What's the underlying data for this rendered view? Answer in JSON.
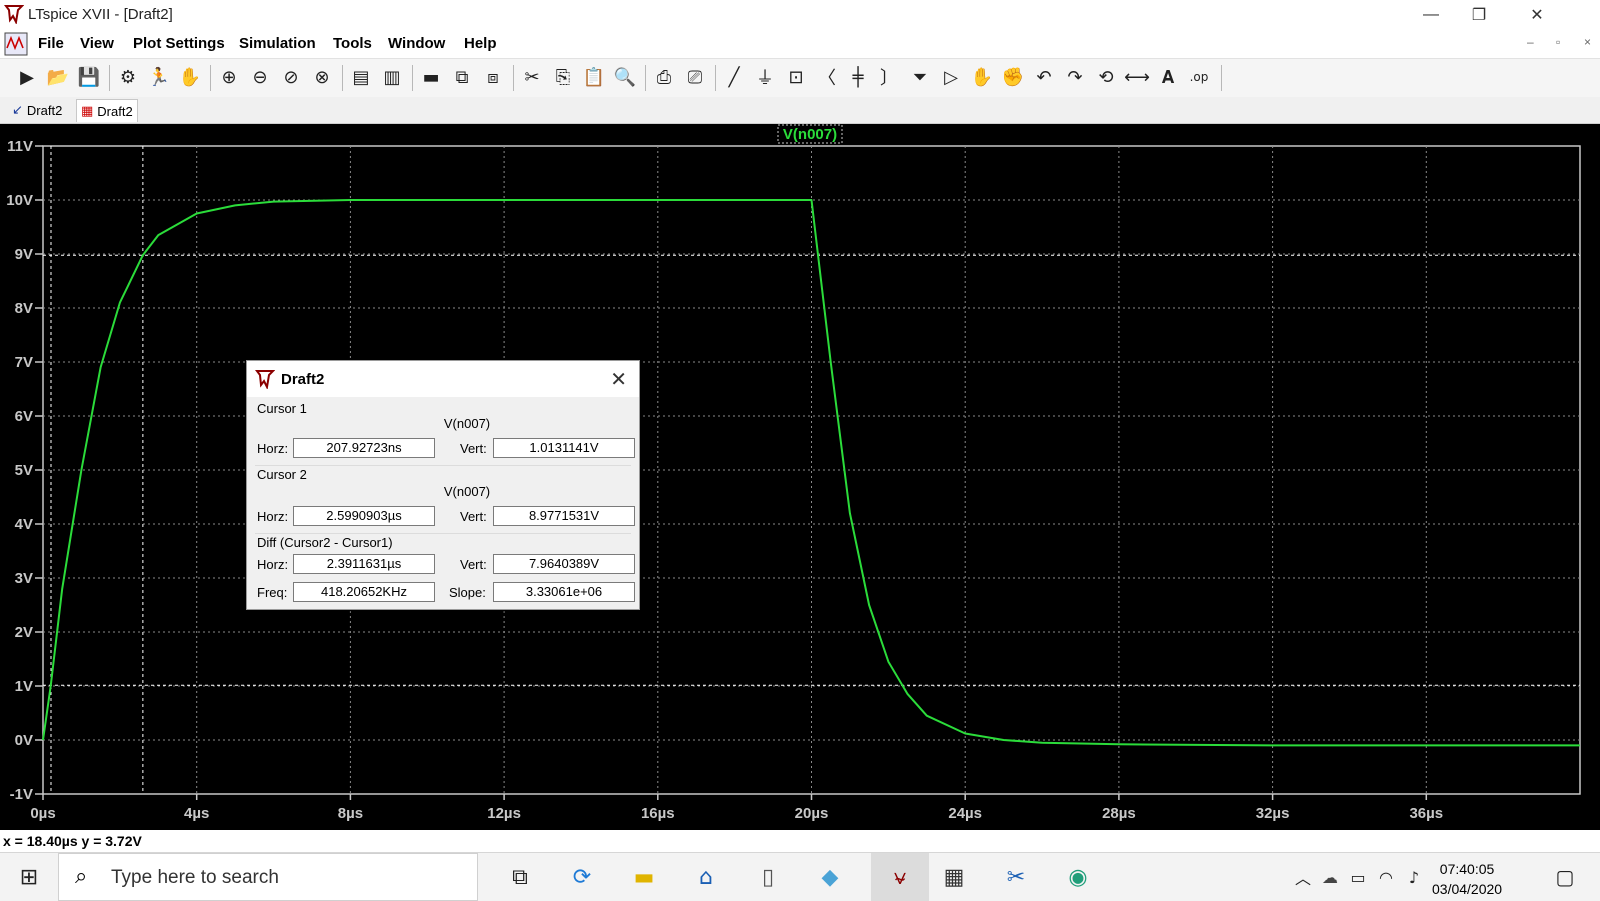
{
  "window": {
    "title": "LTspice XVII - [Draft2]",
    "controls": [
      "—",
      "❐",
      "✕"
    ],
    "mdi_controls": [
      "–",
      "▫",
      "×"
    ]
  },
  "menu": [
    "File",
    "View",
    "Plot Settings",
    "Simulation",
    "Tools",
    "Window",
    "Help"
  ],
  "toolbar_icons": [
    "new-schematic-icon",
    "open-icon",
    "save-icon",
    "control-panel-icon",
    "run-icon",
    "halt-icon",
    "zoom-in-icon",
    "zoom-out-icon",
    "zoom-back-icon",
    "zoom-extents-icon",
    "autorange-icon",
    "manual-limits-icon",
    "add-plot-pane-icon",
    "tile-horizontal-icon",
    "tile-vertical-icon",
    "cut-icon",
    "copy-icon",
    "paste-icon",
    "find-icon",
    "print-icon",
    "print-preview-icon",
    "wire-icon",
    "ground-icon",
    "label-icon",
    "resistor-icon",
    "capacitor-icon",
    "inductor-icon",
    "diode-icon",
    "component-icon",
    "move-icon",
    "drag-icon",
    "undo-icon",
    "redo-icon",
    "rotate-icon",
    "mirror-icon",
    "text-icon",
    "spice-directive-icon"
  ],
  "tabs": [
    "Draft2",
    "Draft2"
  ],
  "plot": {
    "trace_label": "V(n007)",
    "trace_color": "#2bdc3a",
    "background": "#000000"
  },
  "cursor_dialog": {
    "title": "Draft2",
    "cursor1": {
      "label": "Cursor 1",
      "trace": "V(n007)",
      "horz_label": "Horz:",
      "horz": "207.92723ns",
      "vert_label": "Vert:",
      "vert": "1.0131141V"
    },
    "cursor2": {
      "label": "Cursor 2",
      "trace": "V(n007)",
      "horz_label": "Horz:",
      "horz": "2.5990903µs",
      "vert_label": "Vert:",
      "vert": "8.9771531V"
    },
    "diff": {
      "label": "Diff (Cursor2 - Cursor1)",
      "horz_label": "Horz:",
      "horz": "2.3911631µs",
      "vert_label": "Vert:",
      "vert": "7.9640389V",
      "freq_label": "Freq:",
      "freq": "418.20652KHz",
      "slope_label": "Slope:",
      "slope": "3.33061e+06"
    }
  },
  "status_bar": "x = 18.40µs    y = 3.72V",
  "taskbar": {
    "search_placeholder": "Type here to search",
    "time": "07:40:05",
    "date": "03/04/2020"
  },
  "chart_data": {
    "type": "line",
    "title": "",
    "xlabel": "",
    "ylabel": "",
    "xlim": [
      0,
      40
    ],
    "ylim": [
      -1,
      11
    ],
    "x_unit": "µs",
    "y_unit": "V",
    "x_ticks": [
      "0µs",
      "4µs",
      "8µs",
      "12µs",
      "16µs",
      "20µs",
      "24µs",
      "28µs",
      "32µs",
      "36µs"
    ],
    "y_ticks": [
      "11V",
      "10V",
      "9V",
      "8V",
      "7V",
      "6V",
      "5V",
      "4V",
      "3V",
      "2V",
      "1V",
      "0V",
      "-1V"
    ],
    "cursors_x": [
      0.208,
      2.599
    ],
    "cursors_y": [
      1.013,
      8.977
    ],
    "grid": true,
    "series": [
      {
        "name": "V(n007)",
        "x": [
          0,
          0.2,
          0.5,
          1,
          1.5,
          2,
          2.6,
          3,
          4,
          5,
          6,
          8,
          10,
          14,
          18,
          20,
          20.5,
          21,
          21.5,
          22,
          22.5,
          23,
          24,
          25,
          26,
          28,
          32,
          36,
          40
        ],
        "y": [
          0,
          1.0,
          2.8,
          5.0,
          6.9,
          8.1,
          8.98,
          9.35,
          9.75,
          9.9,
          9.97,
          10.0,
          10.0,
          10.0,
          10.0,
          10.0,
          7.0,
          4.2,
          2.5,
          1.45,
          0.85,
          0.45,
          0.12,
          0.0,
          -0.05,
          -0.08,
          -0.1,
          -0.1,
          -0.1
        ]
      }
    ]
  }
}
